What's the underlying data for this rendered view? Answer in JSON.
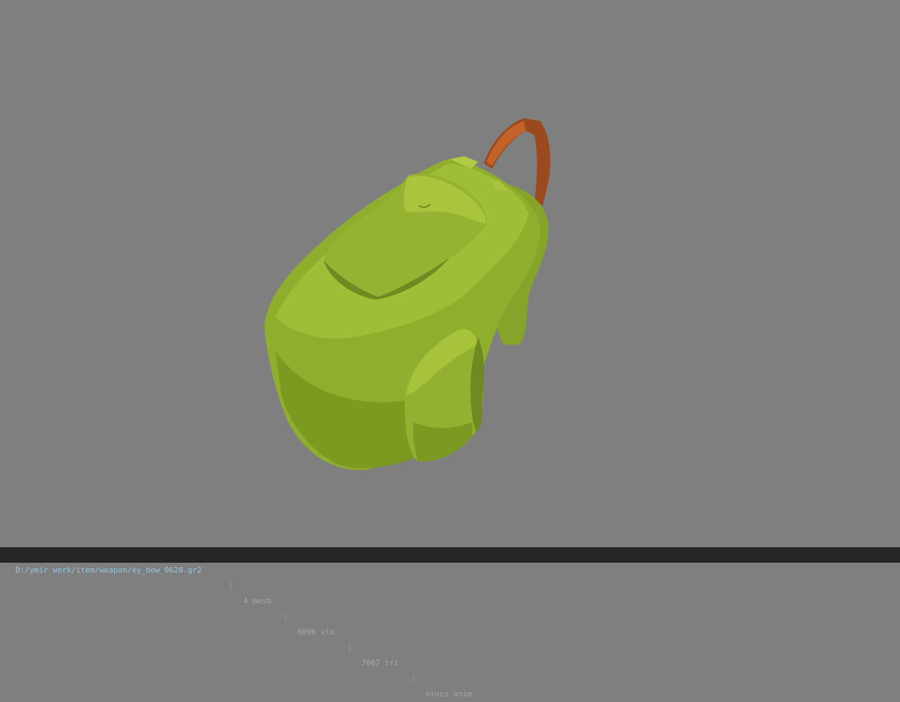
{
  "viewport": {
    "background_color": "#7f7f7f",
    "model": {
      "description_icon": "backpack-model",
      "colors": {
        "body": "#8fae2e",
        "body_light": "#a6c33a",
        "body_shadow": "#6f8a20",
        "strap": "#9a4a1c",
        "strap_light": "#c4622a"
      }
    }
  },
  "status_bar": {
    "file_path": "D:/ymir work/item/weapon/ey_bow_0620.gr2",
    "separator": "|",
    "mesh_count": "4 mesh",
    "vertex_count": "6096 vtx",
    "triangle_count": "7007 tri",
    "anim_status": "nincs anim"
  }
}
